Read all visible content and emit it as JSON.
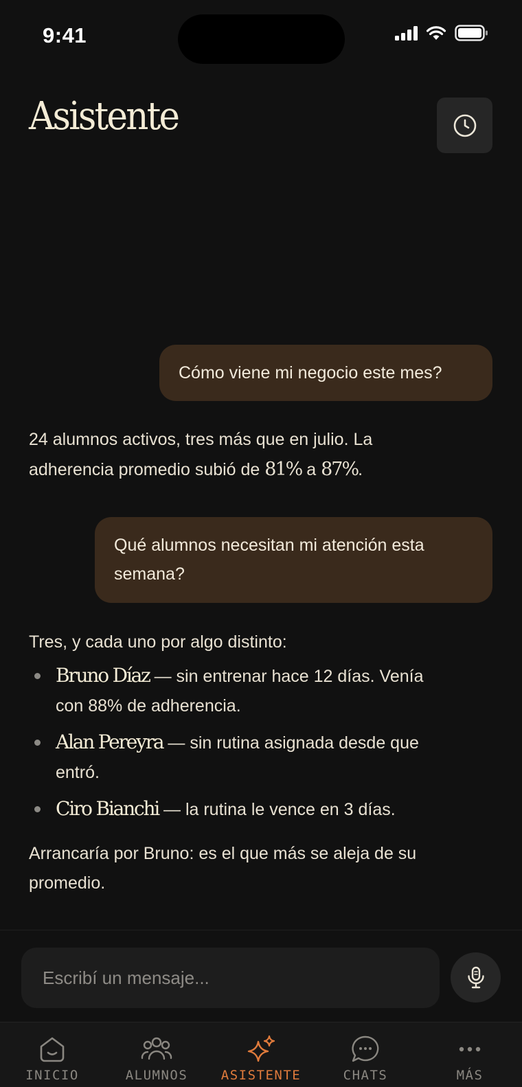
{
  "status_bar": {
    "time": "9:41"
  },
  "header": {
    "title": "Asistente",
    "history_icon": "clock-icon"
  },
  "conversation": {
    "user_1": "Cómo viene mi negocio este mes?",
    "reply_1": {
      "line1": "24 alumnos activos, tres más que en julio. La",
      "line2_prefix": "adherencia promedio subió de ",
      "from_value": "81%",
      "connector": " a ",
      "to_value": "87%",
      "end": "."
    },
    "user_2": {
      "line1": "Qué alumnos necesitan mi atención esta",
      "line2": "semana?"
    },
    "reply_2": {
      "intro": "Tres, y cada uno por algo distinto:",
      "items": [
        {
          "name": "Bruno Díaz",
          "detail_1": " — sin entrenar hace 12 días. Venía",
          "detail_2": "con 88% de adherencia."
        },
        {
          "name": "Alan Pereyra",
          "detail_1": " — sin rutina asignada desde que",
          "detail_2": "entró."
        },
        {
          "name": "Ciro Bianchi",
          "detail_1": " — la rutina le vence en 3 días.",
          "detail_2": ""
        }
      ],
      "closing_1": "Arrancaría por Bruno: es el que más se aleja de su",
      "closing_2": "promedio."
    }
  },
  "composer": {
    "placeholder": "Escribí un mensaje...",
    "mic_icon": "microphone-icon"
  },
  "tabs": [
    {
      "label": "INICIO",
      "icon": "home-icon",
      "active": false
    },
    {
      "label": "ALUMNOS",
      "icon": "users-icon",
      "active": false
    },
    {
      "label": "ASISTENTE",
      "icon": "sparkle-icon",
      "active": true
    },
    {
      "label": "CHATS",
      "icon": "chat-icon",
      "active": false
    },
    {
      "label": "MÁS",
      "icon": "more-icon",
      "active": false
    }
  ],
  "colors": {
    "background": "#111111",
    "user_bubble": "#3a2a1c",
    "accent": "#e07b3c",
    "text": "#ece6d8"
  }
}
